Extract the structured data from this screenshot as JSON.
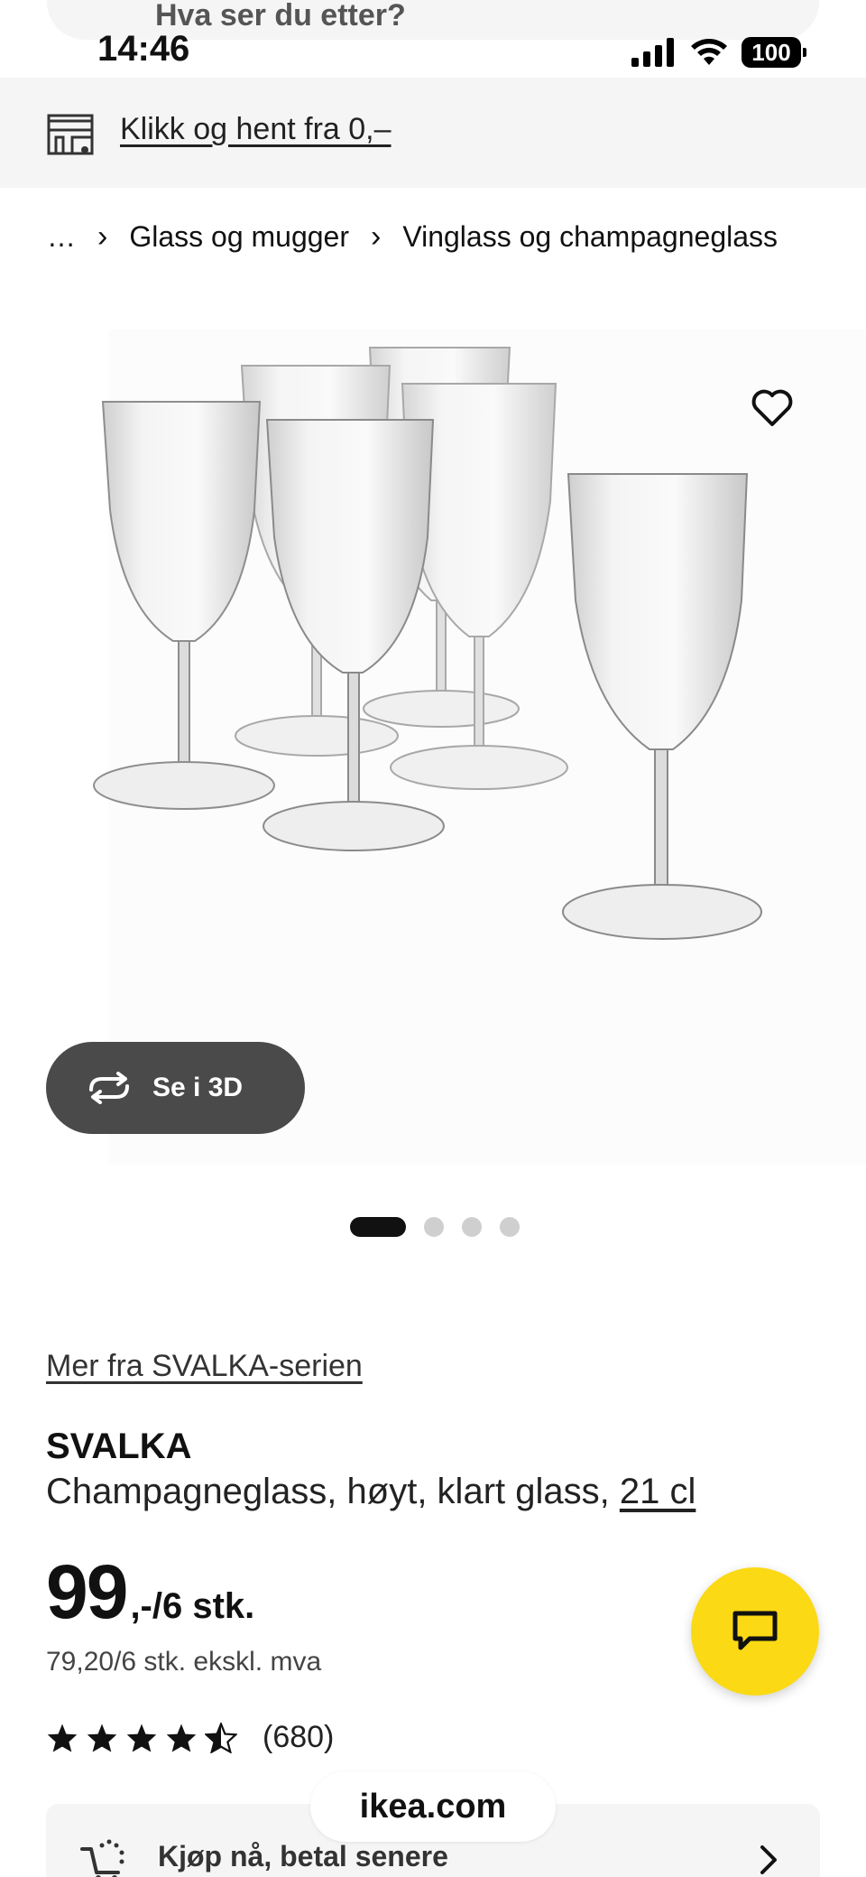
{
  "status_bar": {
    "time": "14:46",
    "battery": "100",
    "icons": [
      "signal-icon",
      "wifi-icon",
      "battery-icon"
    ]
  },
  "search": {
    "partial_text": "Hva ser du etter?"
  },
  "pickup_banner": {
    "icon": "store-pickup-icon",
    "text": "Klikk og hent fra 0,–"
  },
  "breadcrumb": {
    "items": [
      "…",
      "Glass og mugger",
      "Vinglass og champagneglass"
    ]
  },
  "gallery": {
    "view_3d_label": "Se i 3D",
    "slide_count": 4,
    "active_slide": 1
  },
  "product": {
    "series_link": "Mer fra SVALKA-serien",
    "name": "SVALKA",
    "description": "Champagneglass, høyt, klart glass, ",
    "size": "21 cl",
    "price_main": "99",
    "price_suffix": ",-/6 stk.",
    "price_ex_vat": "79,20/6 stk. ekskl. mva",
    "rating_stars": 4.5,
    "rating_count": "(680)"
  },
  "payment": {
    "icon": "cart-pay-icon",
    "label": "Kjøp nå, betal senere"
  },
  "browser": {
    "url": "ikea.com"
  },
  "colors": {
    "chat_fab": "#fbd914",
    "btn_3d": "#4a4a4a",
    "banner_bg": "#f5f5f5"
  }
}
